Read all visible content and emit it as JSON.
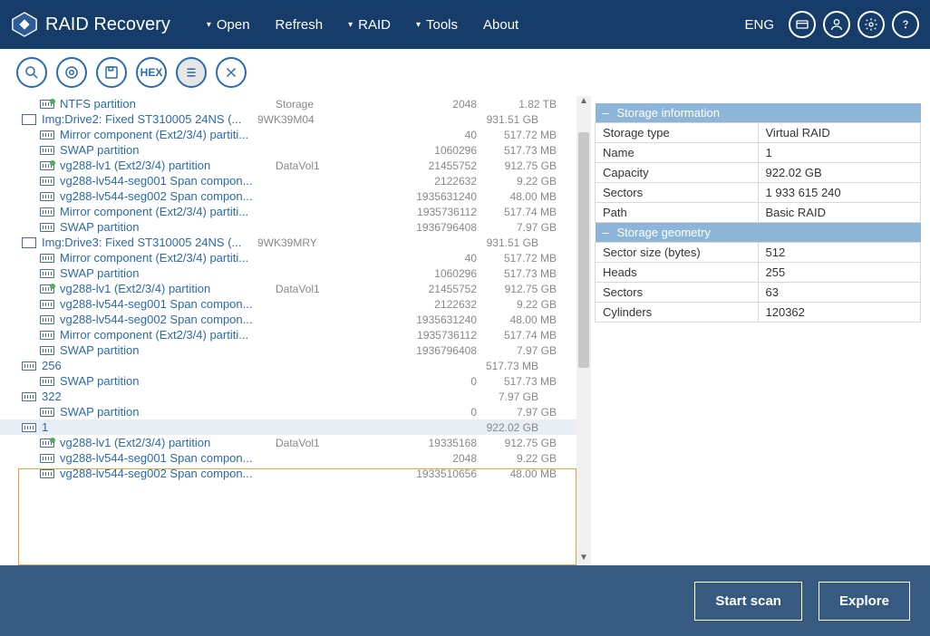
{
  "app": {
    "title": "RAID Recovery"
  },
  "menu": {
    "open": "Open",
    "refresh": "Refresh",
    "raid": "RAID",
    "tools": "Tools",
    "about": "About"
  },
  "lang": "ENG",
  "toolbar": {
    "hex": "HEX"
  },
  "tree": [
    {
      "indent": 1,
      "icon": "green",
      "name": "NTFS partition",
      "label": "Storage",
      "sectors": "2048",
      "size": "1.82 TB"
    },
    {
      "indent": 0,
      "icon": "drive",
      "name": "Img:Drive2: Fixed ST310005 24NS (...",
      "label": "9WK39M04",
      "sectors": "",
      "size": "931.51 GB"
    },
    {
      "indent": 1,
      "icon": "dv",
      "name": "Mirror component (Ext2/3/4) partiti...",
      "label": "",
      "sectors": "40",
      "size": "517.72 MB"
    },
    {
      "indent": 1,
      "icon": "dv",
      "name": "SWAP partition",
      "label": "",
      "sectors": "1060296",
      "size": "517.73 MB"
    },
    {
      "indent": 1,
      "icon": "green",
      "name": "vg288-lv1 (Ext2/3/4) partition",
      "label": "DataVol1",
      "sectors": "21455752",
      "size": "912.75 GB"
    },
    {
      "indent": 1,
      "icon": "dv",
      "name": "vg288-lv544-seg001 Span compon...",
      "label": "",
      "sectors": "2122632",
      "size": "9.22 GB"
    },
    {
      "indent": 1,
      "icon": "dv",
      "name": "vg288-lv544-seg002 Span compon...",
      "label": "",
      "sectors": "1935631240",
      "size": "48.00 MB"
    },
    {
      "indent": 1,
      "icon": "dv",
      "name": "Mirror component (Ext2/3/4) partiti...",
      "label": "",
      "sectors": "1935736112",
      "size": "517.74 MB"
    },
    {
      "indent": 1,
      "icon": "dv",
      "name": "SWAP partition",
      "label": "",
      "sectors": "1936796408",
      "size": "7.97 GB"
    },
    {
      "indent": 0,
      "icon": "drive",
      "name": "Img:Drive3: Fixed ST310005 24NS (...",
      "label": "9WK39MRY",
      "sectors": "",
      "size": "931.51 GB"
    },
    {
      "indent": 1,
      "icon": "dv",
      "name": "Mirror component (Ext2/3/4) partiti...",
      "label": "",
      "sectors": "40",
      "size": "517.72 MB"
    },
    {
      "indent": 1,
      "icon": "dv",
      "name": "SWAP partition",
      "label": "",
      "sectors": "1060296",
      "size": "517.73 MB"
    },
    {
      "indent": 1,
      "icon": "green",
      "name": "vg288-lv1 (Ext2/3/4) partition",
      "label": "DataVol1",
      "sectors": "21455752",
      "size": "912.75 GB"
    },
    {
      "indent": 1,
      "icon": "dv",
      "name": "vg288-lv544-seg001 Span compon...",
      "label": "",
      "sectors": "2122632",
      "size": "9.22 GB"
    },
    {
      "indent": 1,
      "icon": "dv",
      "name": "vg288-lv544-seg002 Span compon...",
      "label": "",
      "sectors": "1935631240",
      "size": "48.00 MB"
    },
    {
      "indent": 1,
      "icon": "dv",
      "name": "Mirror component (Ext2/3/4) partiti...",
      "label": "",
      "sectors": "1935736112",
      "size": "517.74 MB"
    },
    {
      "indent": 1,
      "icon": "dv",
      "name": "SWAP partition",
      "label": "",
      "sectors": "1936796408",
      "size": "7.97 GB"
    },
    {
      "indent": 0,
      "icon": "dv",
      "name": "256",
      "label": "",
      "sectors": "",
      "size": "517.73 MB"
    },
    {
      "indent": 1,
      "icon": "dv",
      "name": "SWAP partition",
      "label": "",
      "sectors": "0",
      "size": "517.73 MB"
    },
    {
      "indent": 0,
      "icon": "dv",
      "name": "322",
      "label": "",
      "sectors": "",
      "size": "7.97 GB"
    },
    {
      "indent": 1,
      "icon": "dv",
      "name": "SWAP partition",
      "label": "",
      "sectors": "0",
      "size": "7.97 GB"
    },
    {
      "indent": 0,
      "icon": "dv",
      "name": "1",
      "label": "",
      "sectors": "",
      "size": "922.02 GB",
      "selected": true
    },
    {
      "indent": 1,
      "icon": "green",
      "name": "vg288-lv1 (Ext2/3/4) partition",
      "label": "DataVol1",
      "sectors": "19335168",
      "size": "912.75 GB"
    },
    {
      "indent": 1,
      "icon": "dv",
      "name": "vg288-lv544-seg001 Span compon...",
      "label": "",
      "sectors": "2048",
      "size": "9.22 GB"
    },
    {
      "indent": 1,
      "icon": "dv",
      "name": "vg288-lv544-seg002 Span compon...",
      "label": "",
      "sectors": "1933510656",
      "size": "48.00 MB"
    }
  ],
  "info": {
    "section1": "Storage information",
    "rows1": [
      {
        "k": "Storage type",
        "v": "Virtual RAID"
      },
      {
        "k": "Name",
        "v": "1"
      },
      {
        "k": "Capacity",
        "v": "922.02 GB"
      },
      {
        "k": "Sectors",
        "v": "1 933 615 240"
      },
      {
        "k": "Path",
        "v": "Basic RAID"
      }
    ],
    "section2": "Storage geometry",
    "rows2": [
      {
        "k": "Sector size (bytes)",
        "v": "512"
      },
      {
        "k": "Heads",
        "v": "255"
      },
      {
        "k": "Sectors",
        "v": "63"
      },
      {
        "k": "Cylinders",
        "v": "120362"
      }
    ]
  },
  "buttons": {
    "scan": "Start scan",
    "explore": "Explore"
  }
}
